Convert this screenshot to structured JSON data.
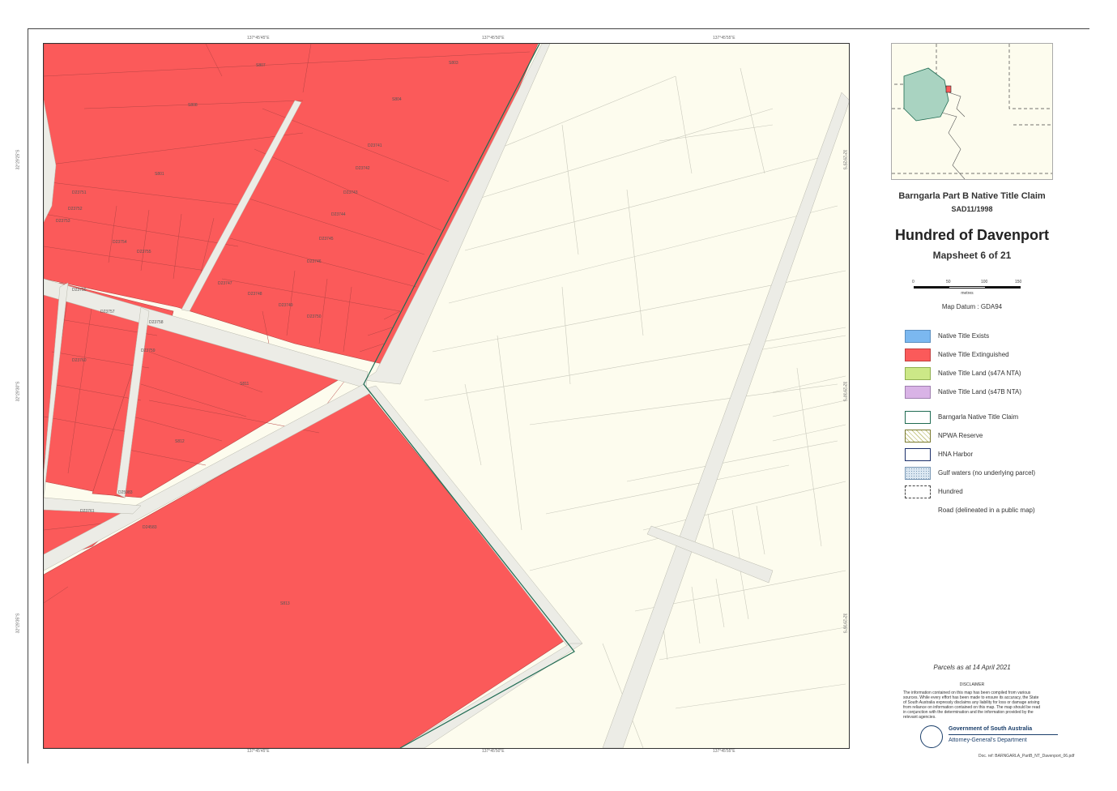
{
  "header": {
    "title": "Barngarla Part B Native Title Claim",
    "claim_number": "SAD11/1998",
    "hundred": "Hundred of Davenport",
    "mapsheet": "Mapsheet 6 of 21"
  },
  "scale": {
    "labels": [
      "0",
      "50",
      "100",
      "150"
    ],
    "units": "metres"
  },
  "datum": "Map Datum : GDA94",
  "legend": [
    {
      "label": "Native Title Exists",
      "fill": "#7bb8f0",
      "border": "#5b8fc0",
      "style": "solid"
    },
    {
      "label": "Native Title Extinguished",
      "fill": "#fb5a5a",
      "border": "#c04040",
      "style": "solid"
    },
    {
      "label": "Native Title Land (s47A NTA)",
      "fill": "#cce887",
      "border": "#90b050",
      "style": "solid"
    },
    {
      "label": "Native Title Land (s47B NTA)",
      "fill": "#d9b3e6",
      "border": "#a080b0",
      "style": "solid"
    },
    {
      "label": "Barngarla Native Title Claim",
      "fill": "#ffffff",
      "border": "#1f6b52",
      "style": "outline-green"
    },
    {
      "label": "NPWA Reserve",
      "fill": "#ffffff",
      "border": "#7a7a30",
      "style": "hatch-olive"
    },
    {
      "label": "HNA Harbor",
      "fill": "#ffffff",
      "border": "#1b2f6b",
      "style": "outline-navy"
    },
    {
      "label": "Gulf waters (no underlying parcel)",
      "fill": "#dce8f2",
      "border": "#7a98b5",
      "style": "stipple"
    },
    {
      "label": "Hundred",
      "fill": "#ffffff",
      "border": "#444444",
      "style": "dashed"
    },
    {
      "label": "Road (delineated in a public map)",
      "fill": "#ffffff",
      "border": "#ffffff",
      "style": "none"
    }
  ],
  "parcels_date": "Parcels as at 14 April 2021",
  "disclaimer": {
    "title": "DISCLAIMER",
    "text": "The information contained on this map has been compiled from various sources. While every effort has been made to ensure its accuracy, the State of South Australia expressly disclaims any liability for loss or damage arising from reliance on information contained on this map. The map should be read in conjunction with the determination and the information provided by the relevant agencies."
  },
  "government": {
    "line1": "Government of South Australia",
    "line2": "Attorney-General's Department"
  },
  "doc_ref": "Doc. ref: BARNGARLA_PartB_NT_Davenport_06.pdf",
  "grid_ticks": {
    "top": [
      "137°45'45\"E",
      "137°45'50\"E",
      "137°45'55\"E"
    ],
    "bottom": [
      "137°45'45\"E",
      "137°45'50\"E",
      "137°45'55\"E"
    ],
    "left": [
      "32°29'25\"S",
      "32°29'30\"S",
      "32°29'35\"S"
    ],
    "right": [
      "32°29'25\"S",
      "32°29'30\"S",
      "32°29'35\"S"
    ]
  },
  "parcel_labels": [
    "S807",
    "S808",
    "S804",
    "S803",
    "S801",
    "D23741",
    "D23742",
    "D23743",
    "D23744",
    "D23745",
    "D23746",
    "D23747",
    "D23748",
    "D23749",
    "D23750",
    "D23751",
    "D23752",
    "D23753",
    "D23754",
    "D23755",
    "S811",
    "S812",
    "S813",
    "D24583",
    "D25983",
    "D23756",
    "D23757",
    "D23758",
    "D23759",
    "D23760",
    "D23761"
  ],
  "colors": {
    "extinguished": "#fb5a5a",
    "background": "#fdfcee",
    "road": "#ecece6",
    "claim_boundary": "#1f6b52"
  }
}
